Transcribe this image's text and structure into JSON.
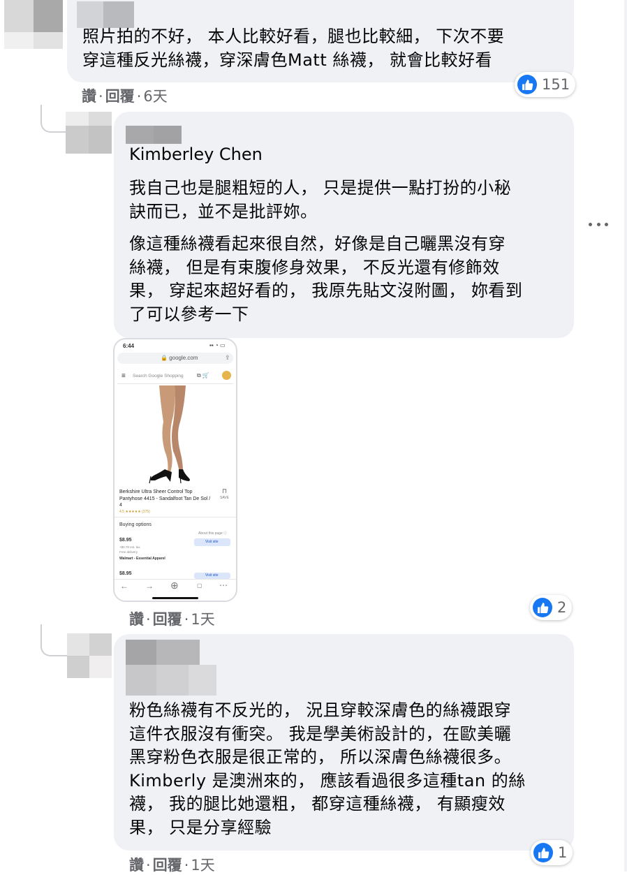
{
  "comment1": {
    "lines": [
      "照片拍的不好， 本人比較好看，腿也比較細， 下次不要",
      "穿這種反光絲襪，穿深膚色Matt 絲襪， 就會比較好看"
    ],
    "like_count": "151",
    "actions": {
      "like": "讚",
      "reply": "回覆",
      "time": "6天"
    }
  },
  "comment2": {
    "author": "Kimberley Chen",
    "para1": [
      "我自己也是腿粗短的人， 只是提供一點打扮的小秘",
      "訣而已，並不是批評妳。"
    ],
    "para2": [
      "像這種絲襪看起來很自然，好像是自己曬黑沒有穿",
      "絲襪， 但是有束腹修身效果， 不反光還有修飾效",
      "果， 穿起來超好看的， 我原先貼文沒附圖， 妳看到",
      "了可以參考一下"
    ],
    "like_count": "2",
    "actions": {
      "like": "讚",
      "reply": "回覆",
      "time": "1天"
    },
    "attachment": {
      "status_time": "6:44",
      "url": "google.com",
      "search_placeholder": "Search Google Shopping",
      "product_title": [
        "Berkshire Ultra Sheer Control Top",
        "Pantyhose 4415 - Sandalfoot Tan De Sol /",
        "4"
      ],
      "save_label": "SAVE",
      "rating": "4.5 ★★★★★ (375)",
      "buying_options": "Buying options",
      "about": "About this page ⓘ",
      "price1": "$8.95",
      "price1_tax": "+$0.78 est. tax",
      "free_delivery": "Free delivery",
      "seller": "Walmart - Essential Apparel",
      "visit_site": "Visit site",
      "price2": "$8.95"
    }
  },
  "comment3": {
    "lines": [
      "粉色絲襪有不反光的， 況且穿較深膚色的絲襪跟穿",
      "這件衣服沒有衝突。 我是學美術設計的，在歐美曬",
      "黑穿粉色衣服是很正常的， 所以深膚色絲襪很多。",
      "Kimberly 是澳洲來的， 應該看過很多這種tan 的絲",
      "襪， 我的腿比她還粗， 都穿這種絲襪， 有顯瘦效",
      "果， 只是分享經驗"
    ],
    "like_count": "1",
    "actions": {
      "like": "讚",
      "reply": "回覆",
      "time": "1天"
    }
  },
  "colors": {
    "bubble": "#eff1f5",
    "like_blue": "#1877f2",
    "meta_gray": "#65676b"
  }
}
